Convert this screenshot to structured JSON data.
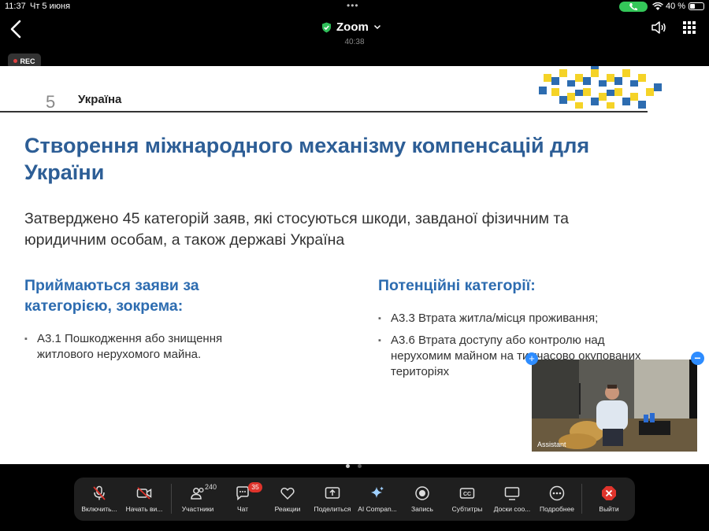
{
  "status_bar": {
    "time": "11:37",
    "date": "Чт 5 июня",
    "battery": "40 %",
    "battery_level": 0.4
  },
  "header": {
    "app_title": "Zoom",
    "meeting_timer": "40:38",
    "rec_label": "REC"
  },
  "slide": {
    "page_number": "5",
    "section": "Україна",
    "title": "Створення міжнародного механізму компенсацій для України",
    "subtitle": "Затверджено 45 категорій заяв, які стосуються шкоди, завданої фізичним та юридичним особам, а також державі Україна",
    "left_heading": "Приймаються заяви за категорією, зокрема:",
    "left_items": [
      "А3.1 Пошкодження або знищення житлового нерухомого майна."
    ],
    "right_heading": "Потенційні категорії:",
    "right_items": [
      "А3.3 Втрата житла/місця проживання;",
      "А3.6 Втрата доступу або контролю над нерухомим майном на тимчасово окупованих територіях"
    ]
  },
  "video": {
    "participant_name": "Assistant"
  },
  "toolbar": {
    "mic": "Включить...",
    "video": "Начать ви...",
    "participants": "Участники",
    "participants_count": "240",
    "chat": "Чат",
    "chat_badge": "35",
    "reactions": "Реакции",
    "share": "Поделиться",
    "ai": "AI Compan...",
    "record": "Запись",
    "captions": "Субтитры",
    "whiteboards": "Доски соо...",
    "more": "Подробнее",
    "leave": "Выйти"
  },
  "colors": {
    "title_blue": "#2d5e96",
    "heading_blue": "#2d6cb0",
    "ornament_yellow": "#f5d327",
    "ornament_blue": "#2d6cb0",
    "call_green": "#34c759",
    "leave_red": "#e0342c",
    "zoom_blue": "#2d8cff"
  }
}
